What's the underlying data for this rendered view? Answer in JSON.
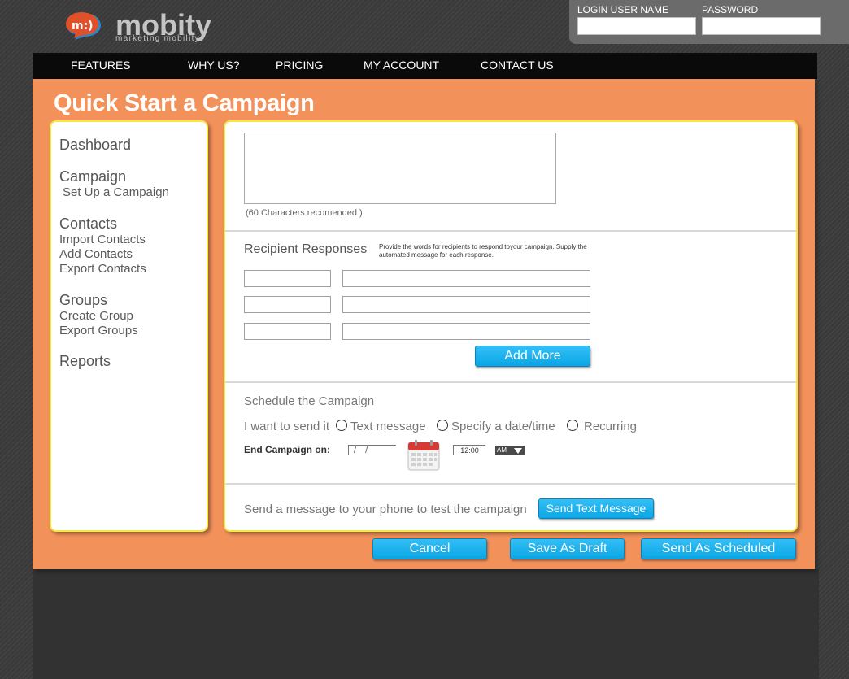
{
  "brand": {
    "name": "mobity",
    "tagline": "marketing mobility",
    "bubble_text": "m:)"
  },
  "login": {
    "username_label": "LOGIN USER NAME",
    "password_label": "PASSWORD",
    "username_value": "",
    "password_value": ""
  },
  "nav": {
    "items": [
      "FEATURES",
      "WHY US?",
      "PRICING",
      "MY ACCOUNT",
      "CONTACT US"
    ]
  },
  "page": {
    "title": "Quick Start a Campaign"
  },
  "sidebar": {
    "sections": [
      {
        "heading": "Dashboard",
        "items": []
      },
      {
        "heading": "Campaign",
        "items": [
          "Set Up a Campaign"
        ]
      },
      {
        "heading": "Contacts",
        "items": [
          "Import Contacts",
          "Add Contacts",
          "Export Contacts"
        ]
      },
      {
        "heading": "Groups",
        "items": [
          "Create Group",
          "Export Groups"
        ]
      },
      {
        "heading": "Reports",
        "items": []
      }
    ]
  },
  "message": {
    "value": "",
    "hint": "(60 Characters recomended )"
  },
  "responses": {
    "title": "Recipient Responses",
    "description": "Provide the words for recipients to respond toyour campaign. Supply the automated message for each response.",
    "rows": [
      {
        "key": "",
        "message": ""
      },
      {
        "key": "",
        "message": ""
      },
      {
        "key": "",
        "message": ""
      }
    ],
    "add_more_label": "Add More"
  },
  "schedule": {
    "title": "Schedule the Campaign",
    "send_prompt": "I want to send it",
    "options": [
      "Text message",
      "Specify a date/time",
      "Recurring"
    ],
    "end_label": "End Campaign on:",
    "date_value": "/ /",
    "time_value": "12:00",
    "ampm_value": "AM"
  },
  "test": {
    "label": "Send a message to your phone to test the campaign",
    "button_label": "Send Text Message"
  },
  "actions": {
    "cancel": "Cancel",
    "save_draft": "Save As Draft",
    "send_scheduled": "Send As Scheduled"
  },
  "colors": {
    "accent": "#f3915b",
    "button": "#19b0ee",
    "panel_border": "#f4e843",
    "nav_bg": "#0a0a0a"
  }
}
